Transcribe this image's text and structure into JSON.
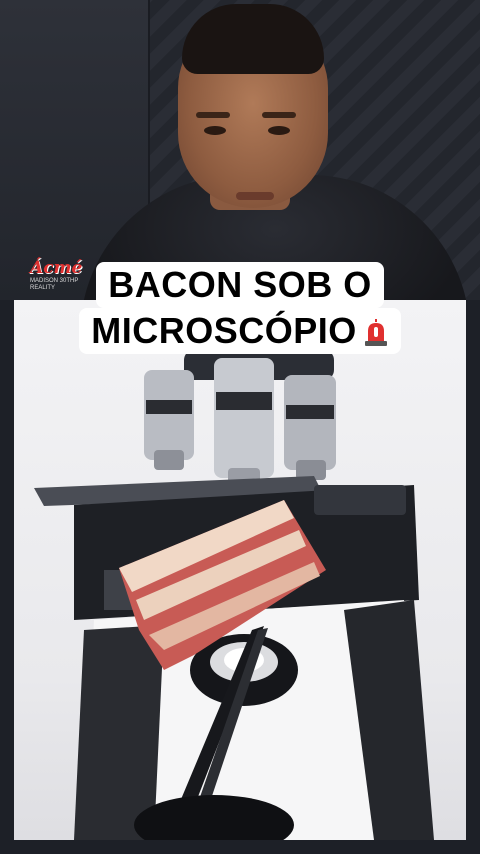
{
  "caption": {
    "line1": "BACON SOB O",
    "line2": "MICROSCÓPIO",
    "emoji": "siren-icon"
  },
  "logo": {
    "main": "Ácmé",
    "sub1": "MADISON 30THP",
    "sub2": "REALITY"
  },
  "colors": {
    "caption_bg": "#ffffff",
    "caption_text": "#000000",
    "siren": "#e0302f",
    "background": "#1d2027"
  }
}
